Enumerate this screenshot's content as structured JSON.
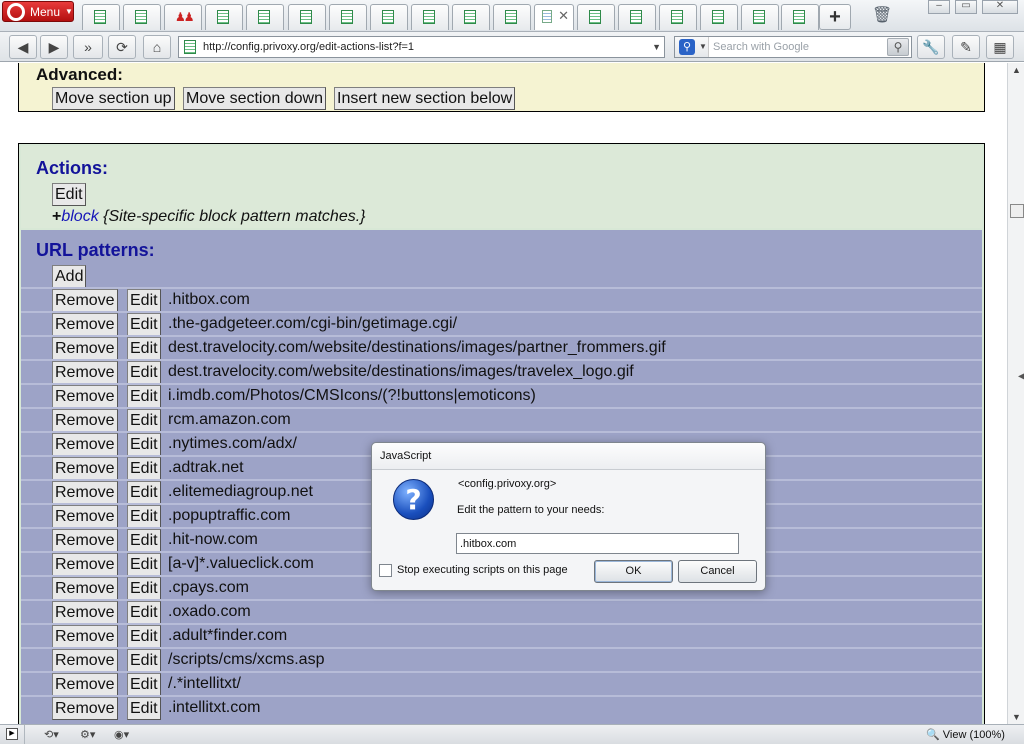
{
  "browser": {
    "menu_label": "Menu",
    "address": "http://config.privoxy.org/edit-actions-list?f=1",
    "search_placeholder": "Search with Google",
    "zoom_label": "View (100%)"
  },
  "page": {
    "advanced_heading": "Advanced:",
    "advanced_buttons": [
      "Move section up",
      "Move section down",
      "Insert new section below"
    ],
    "actions_heading": "Actions:",
    "actions_edit": "Edit",
    "action_prefix": "+",
    "action_keyword": "block",
    "action_comment": " {Site-specific block pattern matches.}",
    "url_heading": "URL patterns:",
    "add_label": "Add",
    "remove_label": "Remove",
    "edit_label": "Edit",
    "patterns": [
      ".hitbox.com",
      ".the-gadgeteer.com/cgi-bin/getimage.cgi/",
      "dest.travelocity.com/website/destinations/images/partner_frommers.gif",
      "dest.travelocity.com/website/destinations/images/travelex_logo.gif",
      "i.imdb.com/Photos/CMSIcons/(?!buttons|emoticons)",
      "rcm.amazon.com",
      ".nytimes.com/adx/",
      ".adtrak.net",
      ".elitemediagroup.net",
      ".popuptraffic.com",
      ".hit-now.com",
      "[a-v]*.valueclick.com",
      ".cpays.com",
      ".oxado.com",
      ".adult*finder.com",
      "/scripts/cms/xcms.asp",
      "/.*intellitxt/",
      ".intellitxt.com"
    ]
  },
  "dialog": {
    "title": "JavaScript",
    "origin": "<config.privoxy.org>",
    "message": "Edit the pattern to your needs:",
    "input_value": ".hitbox.com",
    "checkbox_label": "Stop executing scripts on this page",
    "ok_label": "OK",
    "cancel_label": "Cancel"
  }
}
